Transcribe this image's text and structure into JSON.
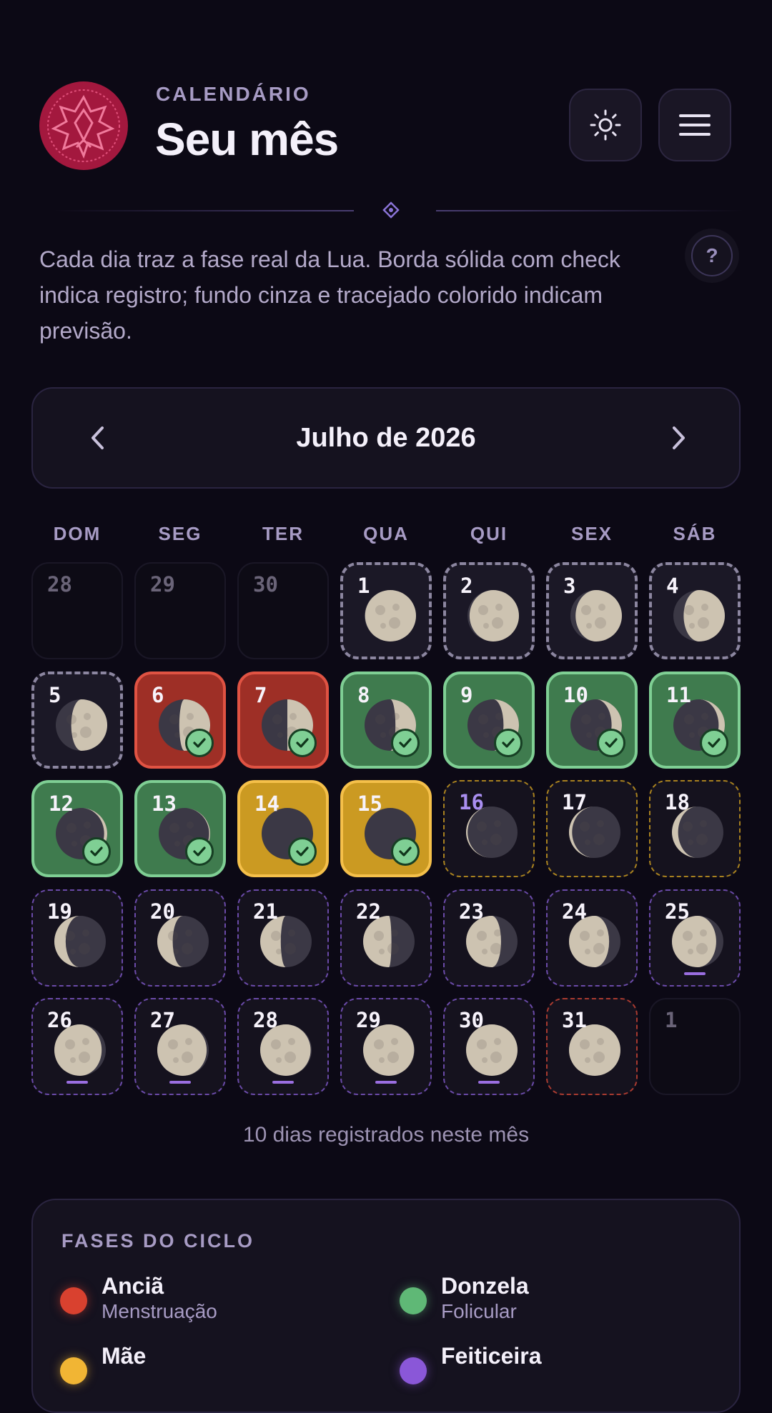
{
  "header": {
    "eyebrow": "CALENDÁRIO",
    "title": "Seu mês",
    "theme_icon": "sun-icon",
    "menu_icon": "hamburger-icon"
  },
  "intro": {
    "text": "Cada dia traz a fase real da Lua. Borda sólida com check indica registro; fundo cinza e tracejado colorido indicam previsão.",
    "help_label": "?"
  },
  "month": {
    "label": "Julho de 2026",
    "prev_icon": "chevron-left-icon",
    "next_icon": "chevron-right-icon"
  },
  "weekdays": [
    "DOM",
    "SEG",
    "TER",
    "QUA",
    "QUI",
    "SEX",
    "SÁB"
  ],
  "days": [
    {
      "n": "28",
      "s": "out"
    },
    {
      "n": "29",
      "s": "out"
    },
    {
      "n": "30",
      "s": "out"
    },
    {
      "n": "1",
      "s": "grey",
      "lit": 0.99,
      "wax": false
    },
    {
      "n": "2",
      "s": "grey",
      "lit": 0.96,
      "wax": false
    },
    {
      "n": "3",
      "s": "grey",
      "lit": 0.9,
      "wax": false
    },
    {
      "n": "4",
      "s": "grey",
      "lit": 0.8,
      "wax": false
    },
    {
      "n": "5",
      "s": "grey",
      "lit": 0.7,
      "wax": false
    },
    {
      "n": "6",
      "s": "red",
      "lit": 0.6,
      "wax": false,
      "check": true
    },
    {
      "n": "7",
      "s": "red",
      "lit": 0.5,
      "wax": false,
      "check": true
    },
    {
      "n": "8",
      "s": "green",
      "lit": 0.4,
      "wax": false,
      "check": true
    },
    {
      "n": "9",
      "s": "green",
      "lit": 0.3,
      "wax": false,
      "check": true
    },
    {
      "n": "10",
      "s": "green",
      "lit": 0.2,
      "wax": false,
      "check": true
    },
    {
      "n": "11",
      "s": "green",
      "lit": 0.12,
      "wax": false,
      "check": true
    },
    {
      "n": "12",
      "s": "green",
      "lit": 0.06,
      "wax": false,
      "check": true
    },
    {
      "n": "13",
      "s": "green",
      "lit": 0.02,
      "wax": false,
      "check": true
    },
    {
      "n": "14",
      "s": "gold",
      "lit": 0.0,
      "wax": false,
      "check": true
    },
    {
      "n": "15",
      "s": "gold",
      "lit": 0.0,
      "wax": false,
      "check": true
    },
    {
      "n": "16",
      "s": "gold-d",
      "lit": 0.03,
      "wax": true,
      "numColor": "#a98ef0"
    },
    {
      "n": "17",
      "s": "gold-d",
      "lit": 0.06,
      "wax": true
    },
    {
      "n": "18",
      "s": "gold-d",
      "lit": 0.12,
      "wax": true
    },
    {
      "n": "19",
      "s": "purp-d",
      "lit": 0.22,
      "wax": true
    },
    {
      "n": "20",
      "s": "purp-d",
      "lit": 0.3,
      "wax": true
    },
    {
      "n": "21",
      "s": "purp-d",
      "lit": 0.4,
      "wax": true
    },
    {
      "n": "22",
      "s": "purp-d",
      "lit": 0.55,
      "wax": true
    },
    {
      "n": "23",
      "s": "purp-d",
      "lit": 0.68,
      "wax": true
    },
    {
      "n": "24",
      "s": "purp-d",
      "lit": 0.78,
      "wax": true
    },
    {
      "n": "25",
      "s": "purp-d",
      "lit": 0.86,
      "wax": true,
      "bar": true
    },
    {
      "n": "26",
      "s": "purp-d",
      "lit": 0.92,
      "wax": true,
      "bar": true
    },
    {
      "n": "27",
      "s": "purp-d",
      "lit": 0.96,
      "wax": true,
      "bar": true
    },
    {
      "n": "28",
      "s": "purp-d",
      "lit": 0.98,
      "wax": true,
      "bar": true
    },
    {
      "n": "29",
      "s": "purp-d",
      "lit": 0.99,
      "wax": true,
      "bar": true
    },
    {
      "n": "30",
      "s": "purp-d",
      "lit": 1.0,
      "wax": true,
      "bar": true
    },
    {
      "n": "31",
      "s": "red-d",
      "lit": 1.0,
      "wax": true
    },
    {
      "n": "1",
      "s": "out"
    }
  ],
  "summary": "10 dias registrados neste mês",
  "legend": {
    "title": "FASES DO CICLO",
    "items": [
      {
        "name": "Anciã",
        "sub": "Menstruação",
        "color": "#d9412f"
      },
      {
        "name": "Donzela",
        "sub": "Folicular",
        "color": "#5fb876"
      },
      {
        "name": "Mãe",
        "sub": "",
        "color": "#f1b534"
      },
      {
        "name": "Feiticeira",
        "sub": "",
        "color": "#8a57d8"
      }
    ]
  },
  "colors": {
    "background": "#0c0915",
    "card": "#15121f",
    "accent": "#9a6ee0"
  }
}
